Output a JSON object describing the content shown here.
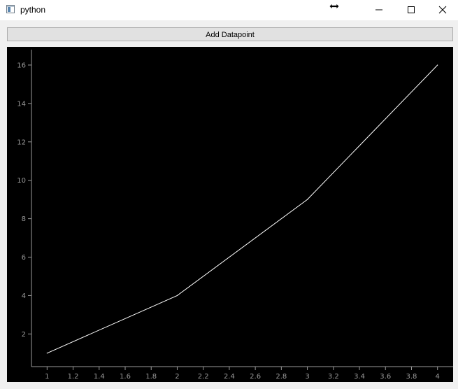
{
  "window": {
    "title": "python",
    "icons": {
      "app": "python-window-icon",
      "cursor": "horizontal-resize-cursor-icon",
      "minimize": "minimize-icon",
      "maximize": "maximize-icon",
      "close": "close-icon"
    }
  },
  "toolbar": {
    "add_datapoint_label": "Add Datapoint"
  },
  "colors": {
    "plot_background": "#000000",
    "axis": "#9a9a9a",
    "line": "#ffffff"
  },
  "chart_data": {
    "type": "line",
    "series": [
      {
        "x": [
          1,
          2,
          3,
          4
        ],
        "y": [
          1,
          4,
          9,
          16
        ]
      }
    ],
    "xlim": [
      0.88,
      4.05
    ],
    "ylim": [
      0.3,
      16.8
    ],
    "x_ticks": [
      "1",
      "1.2",
      "1.4",
      "1.6",
      "1.8",
      "2",
      "2.2",
      "2.4",
      "2.6",
      "2.8",
      "3",
      "3.2",
      "3.4",
      "3.6",
      "3.8",
      "4"
    ],
    "y_ticks": [
      "2",
      "4",
      "6",
      "8",
      "10",
      "12",
      "14",
      "16"
    ],
    "grid": false,
    "legend": "none"
  }
}
